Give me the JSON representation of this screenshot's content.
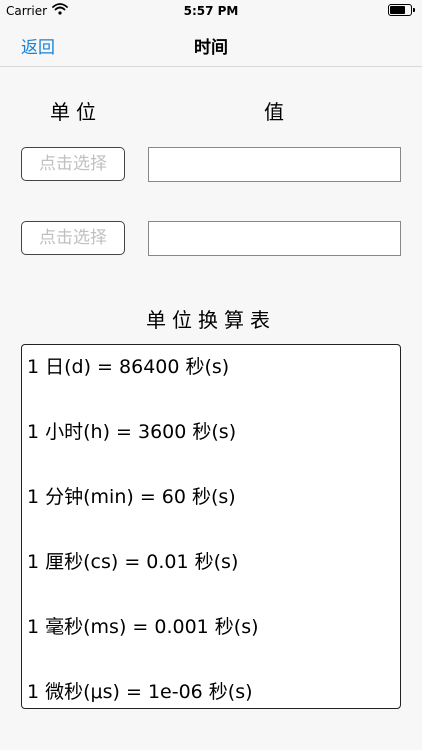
{
  "status_bar": {
    "carrier": "Carrier",
    "time": "5:57 PM"
  },
  "nav": {
    "back_label": "返回",
    "title": "时间"
  },
  "headers": {
    "unit": "单位",
    "value": "值"
  },
  "inputs": [
    {
      "select_label": "点击选择",
      "value": ""
    },
    {
      "select_label": "点击选择",
      "value": ""
    }
  ],
  "table": {
    "title": "单位换算表",
    "rows": [
      "1 日(d) = 86400 秒(s)",
      "1 小时(h) = 3600 秒(s)",
      "1 分钟(min) = 60 秒(s)",
      "1 厘秒(cs) = 0.01 秒(s)",
      "1 毫秒(ms) = 0.001 秒(s)",
      "1 微秒(μs) = 1e-06 秒(s)"
    ]
  },
  "colors": {
    "accent": "#1a82d6",
    "placeholder": "#c0c0c0"
  }
}
